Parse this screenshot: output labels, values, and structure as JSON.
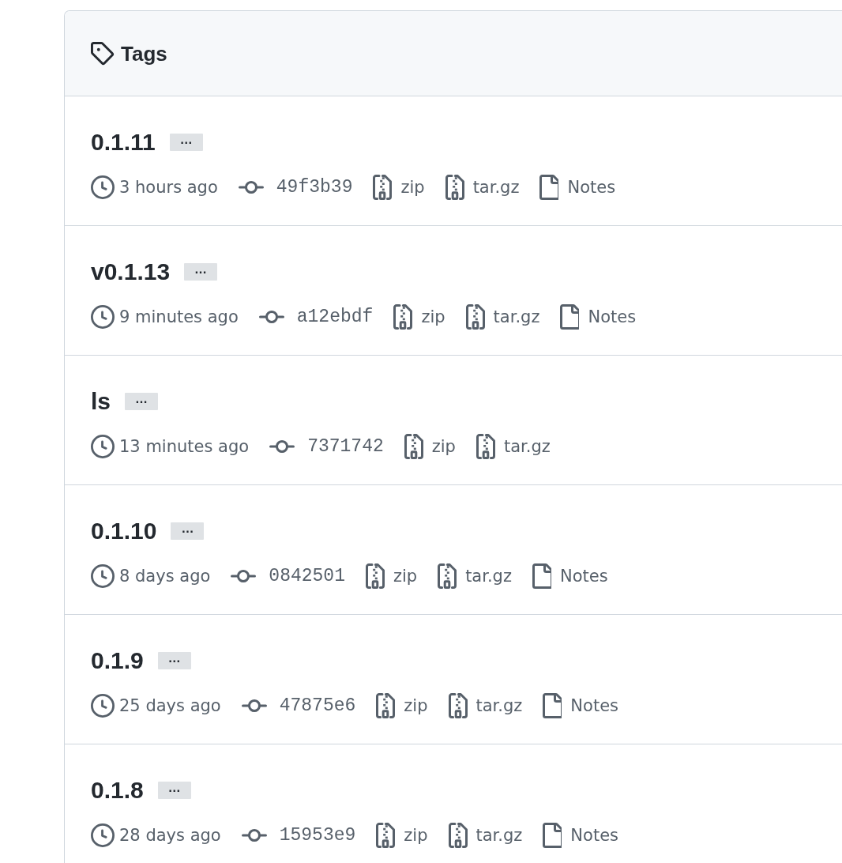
{
  "header": {
    "title": "Tags"
  },
  "tags": [
    {
      "name": "0.1.11",
      "more": "…",
      "time": "3 hours ago",
      "commit": "49f3b39",
      "assets": [
        {
          "kind": "archive",
          "label": "zip"
        },
        {
          "kind": "archive",
          "label": "tar.gz"
        },
        {
          "kind": "notes",
          "label": "Notes"
        }
      ]
    },
    {
      "name": "v0.1.13",
      "more": "…",
      "time": "9 minutes ago",
      "commit": "a12ebdf",
      "assets": [
        {
          "kind": "archive",
          "label": "zip"
        },
        {
          "kind": "archive",
          "label": "tar.gz"
        },
        {
          "kind": "notes",
          "label": "Notes"
        }
      ]
    },
    {
      "name": "ls",
      "more": "…",
      "time": "13 minutes ago",
      "commit": "7371742",
      "assets": [
        {
          "kind": "archive",
          "label": "zip"
        },
        {
          "kind": "archive",
          "label": "tar.gz"
        }
      ]
    },
    {
      "name": "0.1.10",
      "more": "…",
      "time": "8 days ago",
      "commit": "0842501",
      "assets": [
        {
          "kind": "archive",
          "label": "zip"
        },
        {
          "kind": "archive",
          "label": "tar.gz"
        },
        {
          "kind": "notes",
          "label": "Notes"
        }
      ]
    },
    {
      "name": "0.1.9",
      "more": "…",
      "time": "25 days ago",
      "commit": "47875e6",
      "assets": [
        {
          "kind": "archive",
          "label": "zip"
        },
        {
          "kind": "archive",
          "label": "tar.gz"
        },
        {
          "kind": "notes",
          "label": "Notes"
        }
      ]
    },
    {
      "name": "0.1.8",
      "more": "…",
      "time": "28 days ago",
      "commit": "15953e9",
      "assets": [
        {
          "kind": "archive",
          "label": "zip"
        },
        {
          "kind": "archive",
          "label": "tar.gz"
        },
        {
          "kind": "notes",
          "label": "Notes"
        }
      ]
    }
  ]
}
